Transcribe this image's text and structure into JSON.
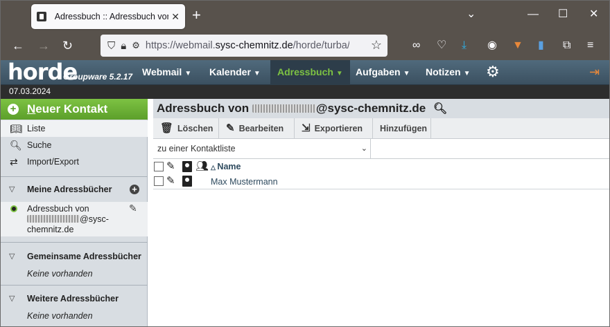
{
  "browser": {
    "tab_title": "Adressbuch :: Adressbuch von :",
    "url_prefix": "https://webmail.",
    "url_domain": "sysc-chemnitz.de",
    "url_suffix": "/horde/turba/b"
  },
  "horde": {
    "logo": "horde",
    "version": "Groupware 5.2.17",
    "menu": [
      {
        "label": "Webmail"
      },
      {
        "label": "Kalender"
      },
      {
        "label": "Adressbuch"
      },
      {
        "label": "Aufgaben"
      },
      {
        "label": "Notizen"
      }
    ],
    "date": "07.03.2024"
  },
  "sidebar": {
    "new_contact_prefix": "N",
    "new_contact_rest": "euer Kontakt",
    "items": [
      {
        "label": "Liste"
      },
      {
        "label": "Suche"
      },
      {
        "label": "Import/Export"
      }
    ],
    "my_books_title": "Meine Adressbücher",
    "my_book_line1": "Adressbuch von",
    "my_book_line2_suffix": "@sysc-",
    "my_book_line3": "chemnitz.de",
    "shared_title": "Gemeinsame Adressbücher",
    "shared_empty": "Keine vorhanden",
    "other_title": "Weitere Adressbücher",
    "other_empty": "Keine vorhanden"
  },
  "main": {
    "title_prefix": "Adressbuch von ",
    "title_suffix": "@sysc-chemnitz.de",
    "toolbar": {
      "delete": "Löschen",
      "edit": "Bearbeiten",
      "export": "Exportieren",
      "add": "Hinzufügen"
    },
    "contact_list_select": "zu einer Kontaktliste",
    "column_name": "Name",
    "contacts": [
      {
        "name": "Max Mustermann"
      }
    ]
  },
  "colors": {
    "horde_bar": "#3b5060",
    "accent_green": "#7dc243",
    "browser_chrome": "#58524c"
  }
}
